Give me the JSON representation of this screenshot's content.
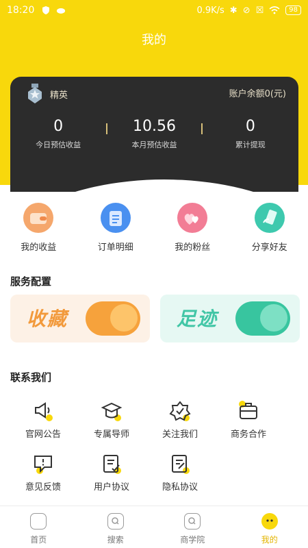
{
  "status_bar": {
    "time": "18:20",
    "network_speed": "0.9K/s",
    "battery": "98"
  },
  "header": {
    "title": "我的"
  },
  "account": {
    "level_label": "精英",
    "balance": "账户余额0(元)",
    "stats": [
      {
        "value": "0",
        "label": "今日预估收益"
      },
      {
        "value": "10.56",
        "label": "本月预估收益"
      },
      {
        "value": "0",
        "label": "累计提现"
      }
    ]
  },
  "quick_entries": [
    {
      "label": "我的收益",
      "icon": "wallet-icon",
      "color": "#f08a4b"
    },
    {
      "label": "订单明细",
      "icon": "order-list-icon",
      "color": "#3f8bf0"
    },
    {
      "label": "我的粉丝",
      "icon": "hearts-icon",
      "color": "#f0607a"
    },
    {
      "label": "分享好友",
      "icon": "share-phone-icon",
      "color": "#36c4a8"
    }
  ],
  "service": {
    "title": "服务配置",
    "cards": [
      {
        "label": "收藏",
        "icon": "heart-planet-icon"
      },
      {
        "label": "足迹",
        "icon": "footprint-planet-icon"
      }
    ]
  },
  "contact": {
    "title": "联系我们",
    "items": [
      {
        "label": "官网公告",
        "icon": "megaphone-icon"
      },
      {
        "label": "专属导师",
        "icon": "graduation-cap-icon"
      },
      {
        "label": "关注我们",
        "icon": "verified-badge-icon"
      },
      {
        "label": "商务合作",
        "icon": "briefcase-icon"
      },
      {
        "label": "意见反馈",
        "icon": "feedback-icon"
      },
      {
        "label": "用户协议",
        "icon": "agreement-icon"
      },
      {
        "label": "隐私协议",
        "icon": "privacy-icon"
      }
    ]
  },
  "tabs": [
    {
      "label": "首页",
      "icon": "home-icon",
      "active": false
    },
    {
      "label": "搜索",
      "icon": "search-icon",
      "active": false
    },
    {
      "label": "商学院",
      "icon": "academy-icon",
      "active": false
    },
    {
      "label": "我的",
      "icon": "profile-icon",
      "active": true
    }
  ],
  "colors": {
    "brand_yellow": "#f8d80c",
    "card_dark": "#2c2c2c",
    "active_tab": "#e3b400"
  }
}
